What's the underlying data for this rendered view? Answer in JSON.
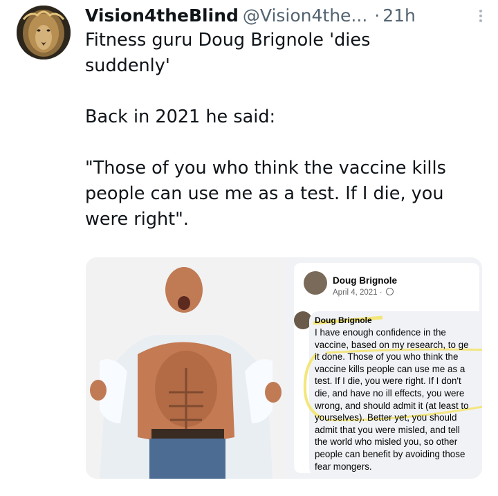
{
  "tweet": {
    "author_name": "Vision4theBlind",
    "author_handle": "@Vision4the...",
    "separator": "·",
    "time": "21h",
    "text_lines": [
      "Fitness guru Doug Brignole 'dies",
      "suddenly'",
      "",
      "Back in 2021 he said:",
      "",
      "\"Those of you who think the vaccine kills",
      "people can use me as a test. If I die, you",
      "were right\"."
    ]
  },
  "facebook_post": {
    "author": "Doug Brignole",
    "date": "April 4, 2021 ·",
    "comment_author": "Doug Brignole",
    "comment_lines": [
      "I have enough confidence in the",
      "vaccine, based on my research, to ge",
      "it done. Those of you who think the",
      "vaccine kills people can use me as a",
      "test. If I die, you were right. If I don't",
      "die, and have no ill effects, you were",
      "wrong, and should admit it (at least to",
      "yourselves). Better yet, you should",
      "admit that you were misled, and tell",
      "the world who misled you, so other",
      "people can benefit by avoiding those",
      "fear mongers."
    ]
  },
  "icons": {
    "avatar": "lion-avatar-icon",
    "more": "more-options-icon",
    "globe": "globe-icon"
  },
  "colors": {
    "text": "#0f1419",
    "secondary": "#536471",
    "highlight": "#f2e36a"
  }
}
